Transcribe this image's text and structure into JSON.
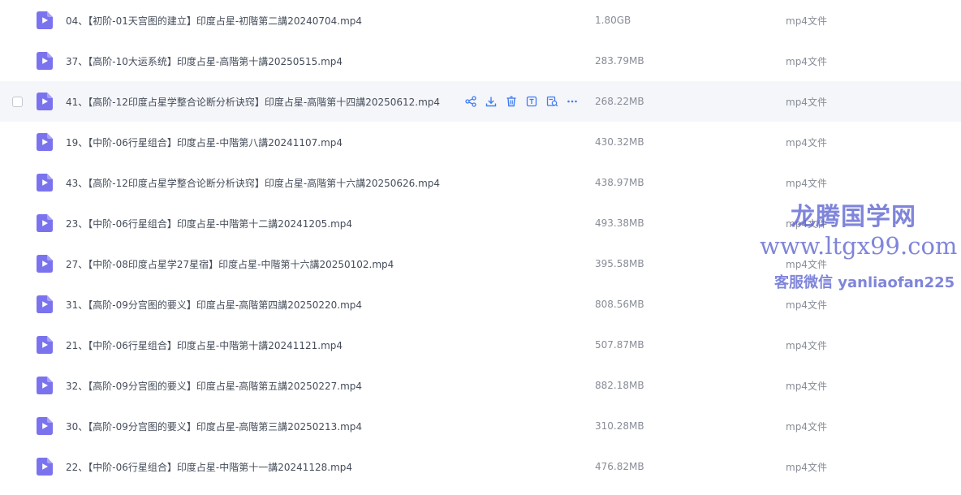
{
  "files": [
    {
      "name": "04、【初阶-01天宫图的建立】印度占星-初階第二講20240704.mp4",
      "size": "1.80GB",
      "type": "mp4文件"
    },
    {
      "name": "37、【高阶-10大运系统】印度占星-高階第十講20250515.mp4",
      "size": "283.79MB",
      "type": "mp4文件"
    },
    {
      "name": "41、【高阶-12印度占星学整合论断分析诀窍】印度占星-高階第十四講20250612.mp4",
      "size": "268.22MB",
      "type": "mp4文件"
    },
    {
      "name": "19、【中阶-06行星组合】印度占星-中階第八講20241107.mp4",
      "size": "430.32MB",
      "type": "mp4文件"
    },
    {
      "name": "43、【高阶-12印度占星学整合论断分析诀窍】印度占星-高階第十六講20250626.mp4",
      "size": "438.97MB",
      "type": "mp4文件"
    },
    {
      "name": "23、【中阶-06行星组合】印度占星-中階第十二講20241205.mp4",
      "size": "493.38MB",
      "type": "mp4文件"
    },
    {
      "name": "27、【中阶-08印度占星学27星宿】印度占星-中階第十六講20250102.mp4",
      "size": "395.58MB",
      "type": "mp4文件"
    },
    {
      "name": "31、【高阶-09分宫图的要义】印度占星-高階第四講20250220.mp4",
      "size": "808.56MB",
      "type": "mp4文件"
    },
    {
      "name": "21、【中阶-06行星组合】印度占星-中階第十講20241121.mp4",
      "size": "507.87MB",
      "type": "mp4文件"
    },
    {
      "name": "32、【高阶-09分宫图的要义】印度占星-高階第五講20250227.mp4",
      "size": "882.18MB",
      "type": "mp4文件"
    },
    {
      "name": "30、【高阶-09分宫图的要义】印度占星-高階第三講20250213.mp4",
      "size": "310.28MB",
      "type": "mp4文件"
    },
    {
      "name": "22、【中阶-06行星组合】印度占星-中階第十一講20241128.mp4",
      "size": "476.82MB",
      "type": "mp4文件"
    }
  ],
  "hovered_row_index": 2,
  "row_actions": [
    "share-icon",
    "download-icon",
    "delete-icon",
    "rename-icon",
    "search-in-file-icon",
    "more-icon"
  ],
  "watermark": {
    "title": "龙腾国学网",
    "url": "www.ltgx99.com",
    "contact": "客服微信 yanliaofan225"
  },
  "colors": {
    "icon_purple": "#7b73ee",
    "action_blue": "#3f7cf4",
    "hover_bg": "#f5f6fa",
    "watermark": "#5c63d0"
  }
}
